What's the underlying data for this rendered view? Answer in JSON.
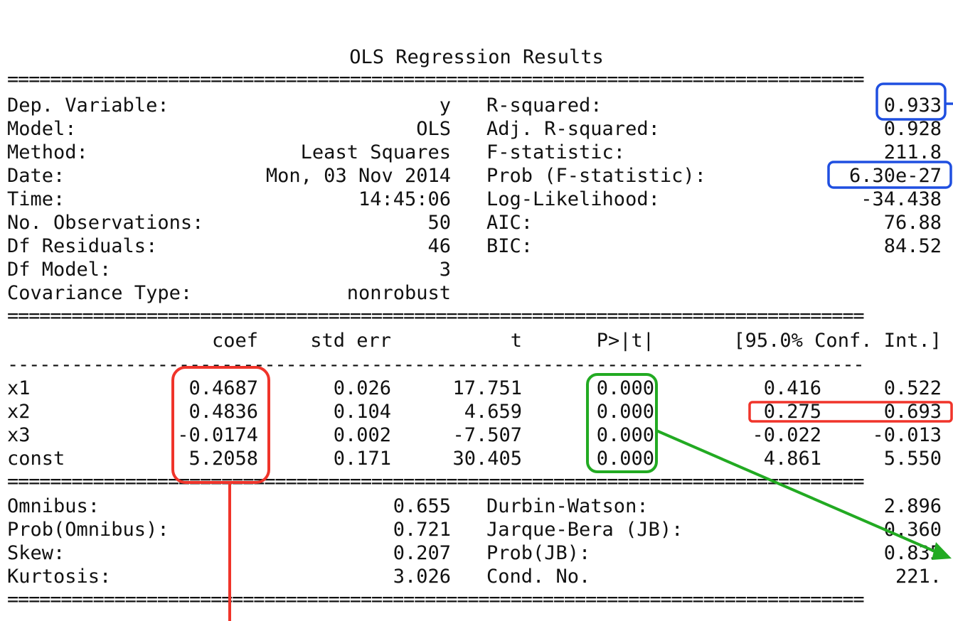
{
  "title": "OLS Regression Results",
  "rule_double": "================================================================================",
  "rule_single": "--------------------------------------------------------------------------------",
  "summary_left": [
    {
      "label": "Dep. Variable:",
      "value": "y"
    },
    {
      "label": "Model:",
      "value": "OLS"
    },
    {
      "label": "Method:",
      "value": "Least Squares"
    },
    {
      "label": "Date:",
      "value": "Mon, 03 Nov 2014"
    },
    {
      "label": "Time:",
      "value": "14:45:06"
    },
    {
      "label": "No. Observations:",
      "value": "50"
    },
    {
      "label": "Df Residuals:",
      "value": "46"
    },
    {
      "label": "Df Model:",
      "value": "3"
    },
    {
      "label": "Covariance Type:",
      "value": "nonrobust"
    }
  ],
  "summary_right": [
    {
      "label": "R-squared:",
      "value": "0.933"
    },
    {
      "label": "Adj. R-squared:",
      "value": "0.928"
    },
    {
      "label": "F-statistic:",
      "value": "211.8"
    },
    {
      "label": "Prob (F-statistic):",
      "value": "6.30e-27"
    },
    {
      "label": "Log-Likelihood:",
      "value": "-34.438"
    },
    {
      "label": "AIC:",
      "value": "76.88"
    },
    {
      "label": "BIC:",
      "value": "84.52"
    }
  ],
  "coef_headers": [
    "coef",
    "std err",
    "t",
    "P>|t|",
    "[95.0% Conf. Int.]"
  ],
  "coef_rows": [
    {
      "name": "x1",
      "coef": "0.4687",
      "std_err": "0.026",
      "t": "17.751",
      "p": "0.000",
      "ci_low": "0.416",
      "ci_high": "0.522"
    },
    {
      "name": "x2",
      "coef": "0.4836",
      "std_err": "0.104",
      "t": "4.659",
      "p": "0.000",
      "ci_low": "0.275",
      "ci_high": "0.693"
    },
    {
      "name": "x3",
      "coef": "-0.0174",
      "std_err": "0.002",
      "t": "-7.507",
      "p": "0.000",
      "ci_low": "-0.022",
      "ci_high": "-0.013"
    },
    {
      "name": "const",
      "coef": "5.2058",
      "std_err": "0.171",
      "t": "30.405",
      "p": "0.000",
      "ci_low": "4.861",
      "ci_high": "5.550"
    }
  ],
  "diag_left": [
    {
      "label": "Omnibus:",
      "value": "0.655"
    },
    {
      "label": "Prob(Omnibus):",
      "value": "0.721"
    },
    {
      "label": "Skew:",
      "value": "0.207"
    },
    {
      "label": "Kurtosis:",
      "value": "3.026"
    }
  ],
  "diag_right": [
    {
      "label": "Durbin-Watson:",
      "value": "2.896"
    },
    {
      "label": "Jarque-Bera (JB):",
      "value": "0.360"
    },
    {
      "label": "Prob(JB):",
      "value": "0.835"
    },
    {
      "label": "Cond. No.",
      "value": "221."
    }
  ],
  "annotation_colors": {
    "blue": "#1f4fe0",
    "red": "#f0342a",
    "green": "#22aa22"
  }
}
